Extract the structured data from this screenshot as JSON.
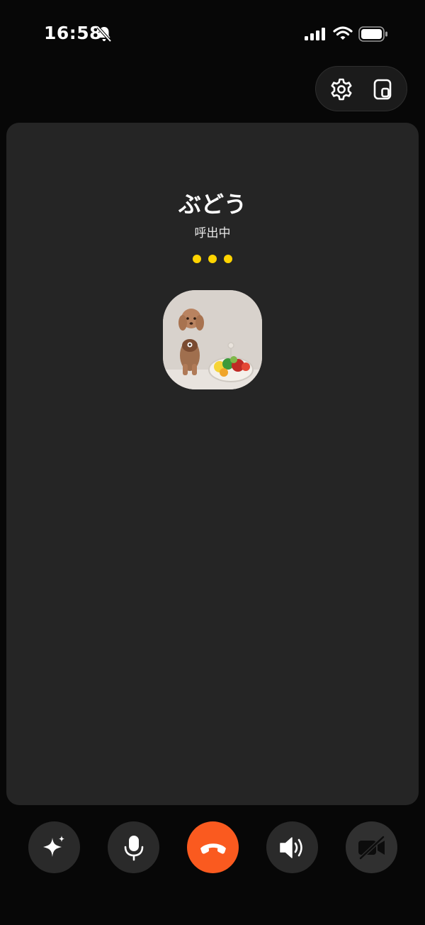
{
  "status_bar": {
    "time": "16:58",
    "icons": [
      "bell-muted-icon",
      "cellular-signal-icon",
      "wifi-icon",
      "battery-icon"
    ]
  },
  "top_controls": {
    "icons": [
      "settings-icon",
      "picture-in-picture-icon"
    ]
  },
  "call": {
    "contact_name": "ぶどう",
    "status": "呼出中",
    "indicator_color": "#ffd400",
    "avatar": "dog-photo-avatar"
  },
  "controls": {
    "icons": [
      "ai-sparkle-icon",
      "microphone-icon",
      "end-call-icon",
      "speaker-icon",
      "camera-off-icon"
    ],
    "end_call_color": "#fa5a1f"
  }
}
